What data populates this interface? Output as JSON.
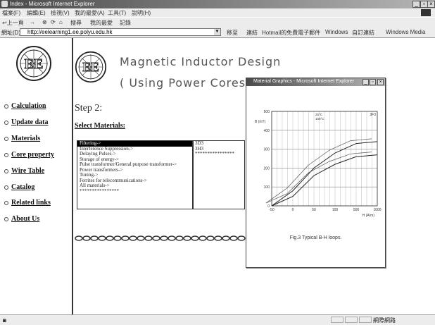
{
  "window": {
    "title": "Index - Microsoft Internet Explorer",
    "min": "_",
    "max": "▫",
    "close": "×"
  },
  "menu": [
    "檔案(F)",
    "編輯(E)",
    "檢視(V)",
    "我的最愛(A)",
    "工具(T)",
    "說明(H)"
  ],
  "toolbar": {
    "back": "↩上一頁",
    "forward": "→",
    "stop": "⊗",
    "refresh": "⟳",
    "home": "⌂",
    "search": "搜尋",
    "favorites": "我的最愛",
    "history": "記錄"
  },
  "address": {
    "label": "網址(D)",
    "url": "http://eelearning1.ee.polyu.edu.hk",
    "go": "移至",
    "links_label": "連結",
    "links": [
      "Hotmail的免費電子郵件",
      "Windows",
      "自訂連結",
      "Windows Media"
    ]
  },
  "logo": {
    "text": "EE"
  },
  "nav": [
    "Calculation",
    "Update data",
    "Materials",
    "Core property",
    "Wire Table",
    "Catalog",
    "Related links",
    "About Us"
  ],
  "banner": {
    "line1": "Magnetic Inductor Design",
    "line2": "( Using Power Cores )"
  },
  "step": "Step 2:",
  "select_title": "Select Materials:",
  "materials": [
    "Filtering->",
    "Interference Suppression->",
    "Delaying Pulses->",
    "Storage of energy->",
    "Pulse transformer/General purpose transformer->",
    "Power transformers->",
    "Tuning->",
    "Ferrites for telecommunications->",
    "All materials->",
    "****************"
  ],
  "selected_material_index": 0,
  "grades": [
    "3D3",
    "3H3",
    "****************"
  ],
  "popup": {
    "title": "Material Graphics - Microsoft Internet Explorer",
    "caption": "Fig.3 Typical B-H loops."
  },
  "chart_data": {
    "type": "line",
    "title": "",
    "xlabel": "H (A/m)",
    "ylabel": "B (mT)",
    "xlim": [
      -50,
      1000
    ],
    "ylim": [
      0,
      500
    ],
    "x_ticks": [
      "-50",
      "0",
      "50",
      "100",
      "500",
      "1000"
    ],
    "y_ticks": [
      "0",
      "100",
      "200",
      "300",
      "400",
      "500"
    ],
    "legend": [
      "25°C",
      "100°C"
    ],
    "corner_label": "3F3",
    "series": [
      {
        "name": "25°C",
        "points": [
          [
            -50,
            0
          ],
          [
            0,
            80
          ],
          [
            50,
            200
          ],
          [
            100,
            280
          ],
          [
            500,
            330
          ],
          [
            1000,
            340
          ]
        ]
      },
      {
        "name": "100°C",
        "points": [
          [
            -50,
            0
          ],
          [
            0,
            50
          ],
          [
            50,
            160
          ],
          [
            100,
            220
          ],
          [
            500,
            260
          ],
          [
            1000,
            270
          ]
        ]
      }
    ],
    "grid": true,
    "legend_placement": "top-center"
  },
  "status": {
    "icon": "◙",
    "zone": "網際網路"
  }
}
